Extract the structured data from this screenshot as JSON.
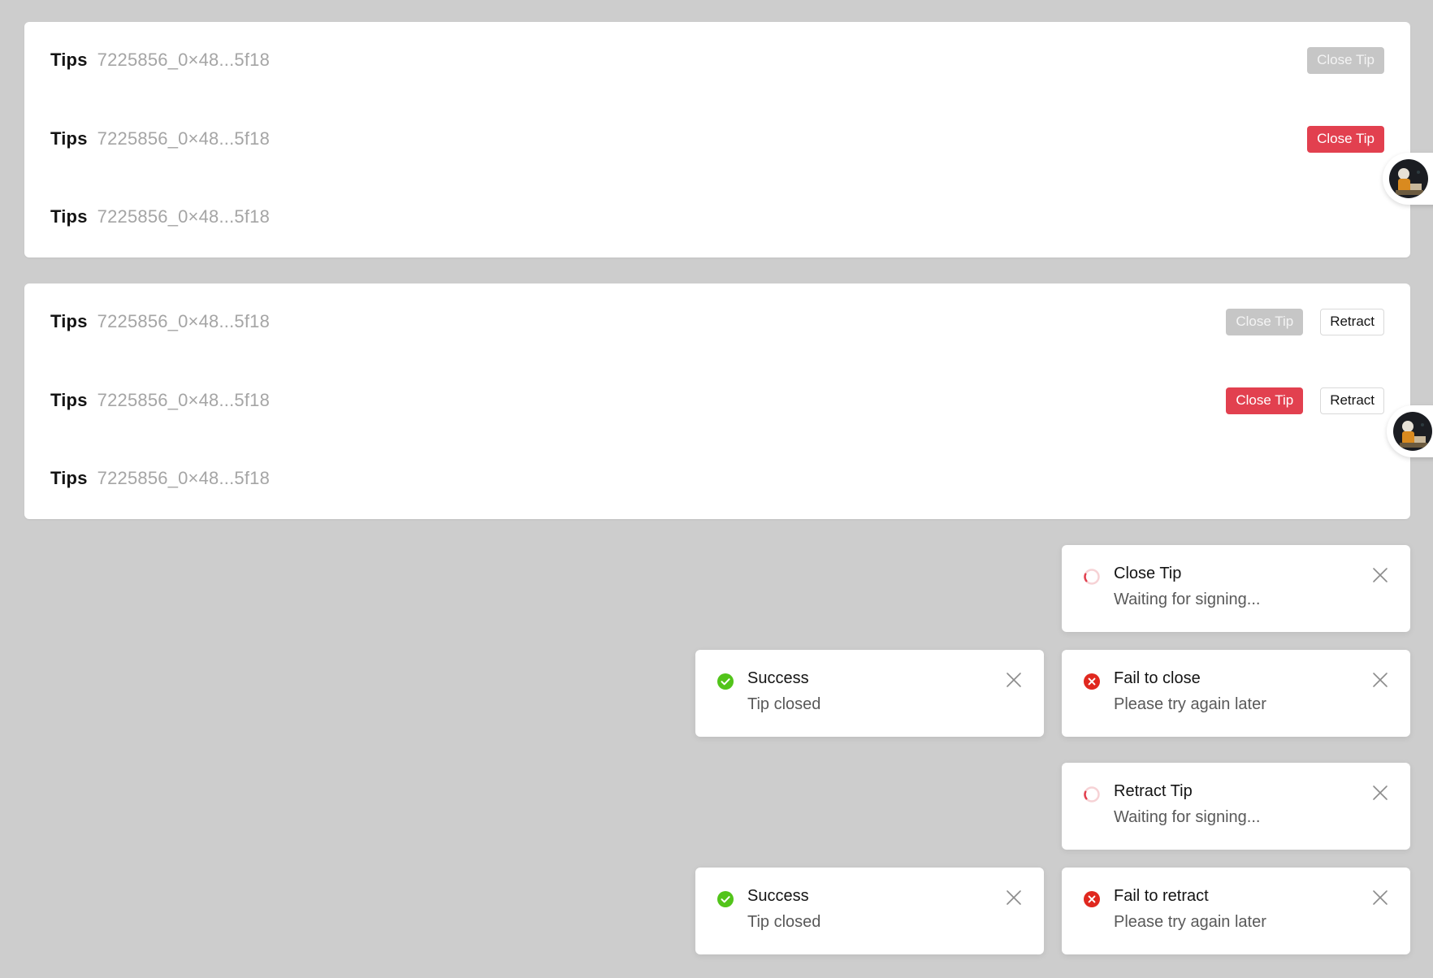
{
  "colors": {
    "background": "#cdcdcd",
    "primary_red": "#e2404f",
    "disabled_gray": "#c6c6c6",
    "success_green": "#52c41a",
    "error_red": "#e0281f"
  },
  "panel_1": {
    "rows": [
      {
        "label": "Tips",
        "address": "7225856_0×48...5f18",
        "button_label": "Close Tip",
        "button_state": "disabled"
      },
      {
        "label": "Tips",
        "address": "7225856_0×48...5f18",
        "button_label": "Close Tip",
        "button_state": "active"
      },
      {
        "label": "Tips",
        "address": "7225856_0×48...5f18"
      }
    ]
  },
  "panel_2": {
    "rows": [
      {
        "label": "Tips",
        "address": "7225856_0×48...5f18",
        "button_label": "Close Tip",
        "button_state": "disabled",
        "retract_label": "Retract"
      },
      {
        "label": "Tips",
        "address": "7225856_0×48...5f18",
        "button_label": "Close Tip",
        "button_state": "active",
        "retract_label": "Retract"
      },
      {
        "label": "Tips",
        "address": "7225856_0×48...5f18"
      }
    ]
  },
  "toasts": {
    "close_loading": {
      "icon": "spinner-icon",
      "title": "Close Tip",
      "message": "Waiting for signing..."
    },
    "close_success": {
      "icon": "check-circle-icon",
      "title": "Success",
      "message": "Tip closed"
    },
    "close_fail": {
      "icon": "error-circle-icon",
      "title": "Fail to close",
      "message": "Please try again later"
    },
    "retract_loading": {
      "icon": "spinner-icon",
      "title": "Retract Tip",
      "message": "Waiting for signing..."
    },
    "retract_success": {
      "icon": "check-circle-icon",
      "title": "Success",
      "message": "Tip closed"
    },
    "retract_fail": {
      "icon": "error-circle-icon",
      "title": "Fail to retract",
      "message": "Please try again later"
    }
  }
}
